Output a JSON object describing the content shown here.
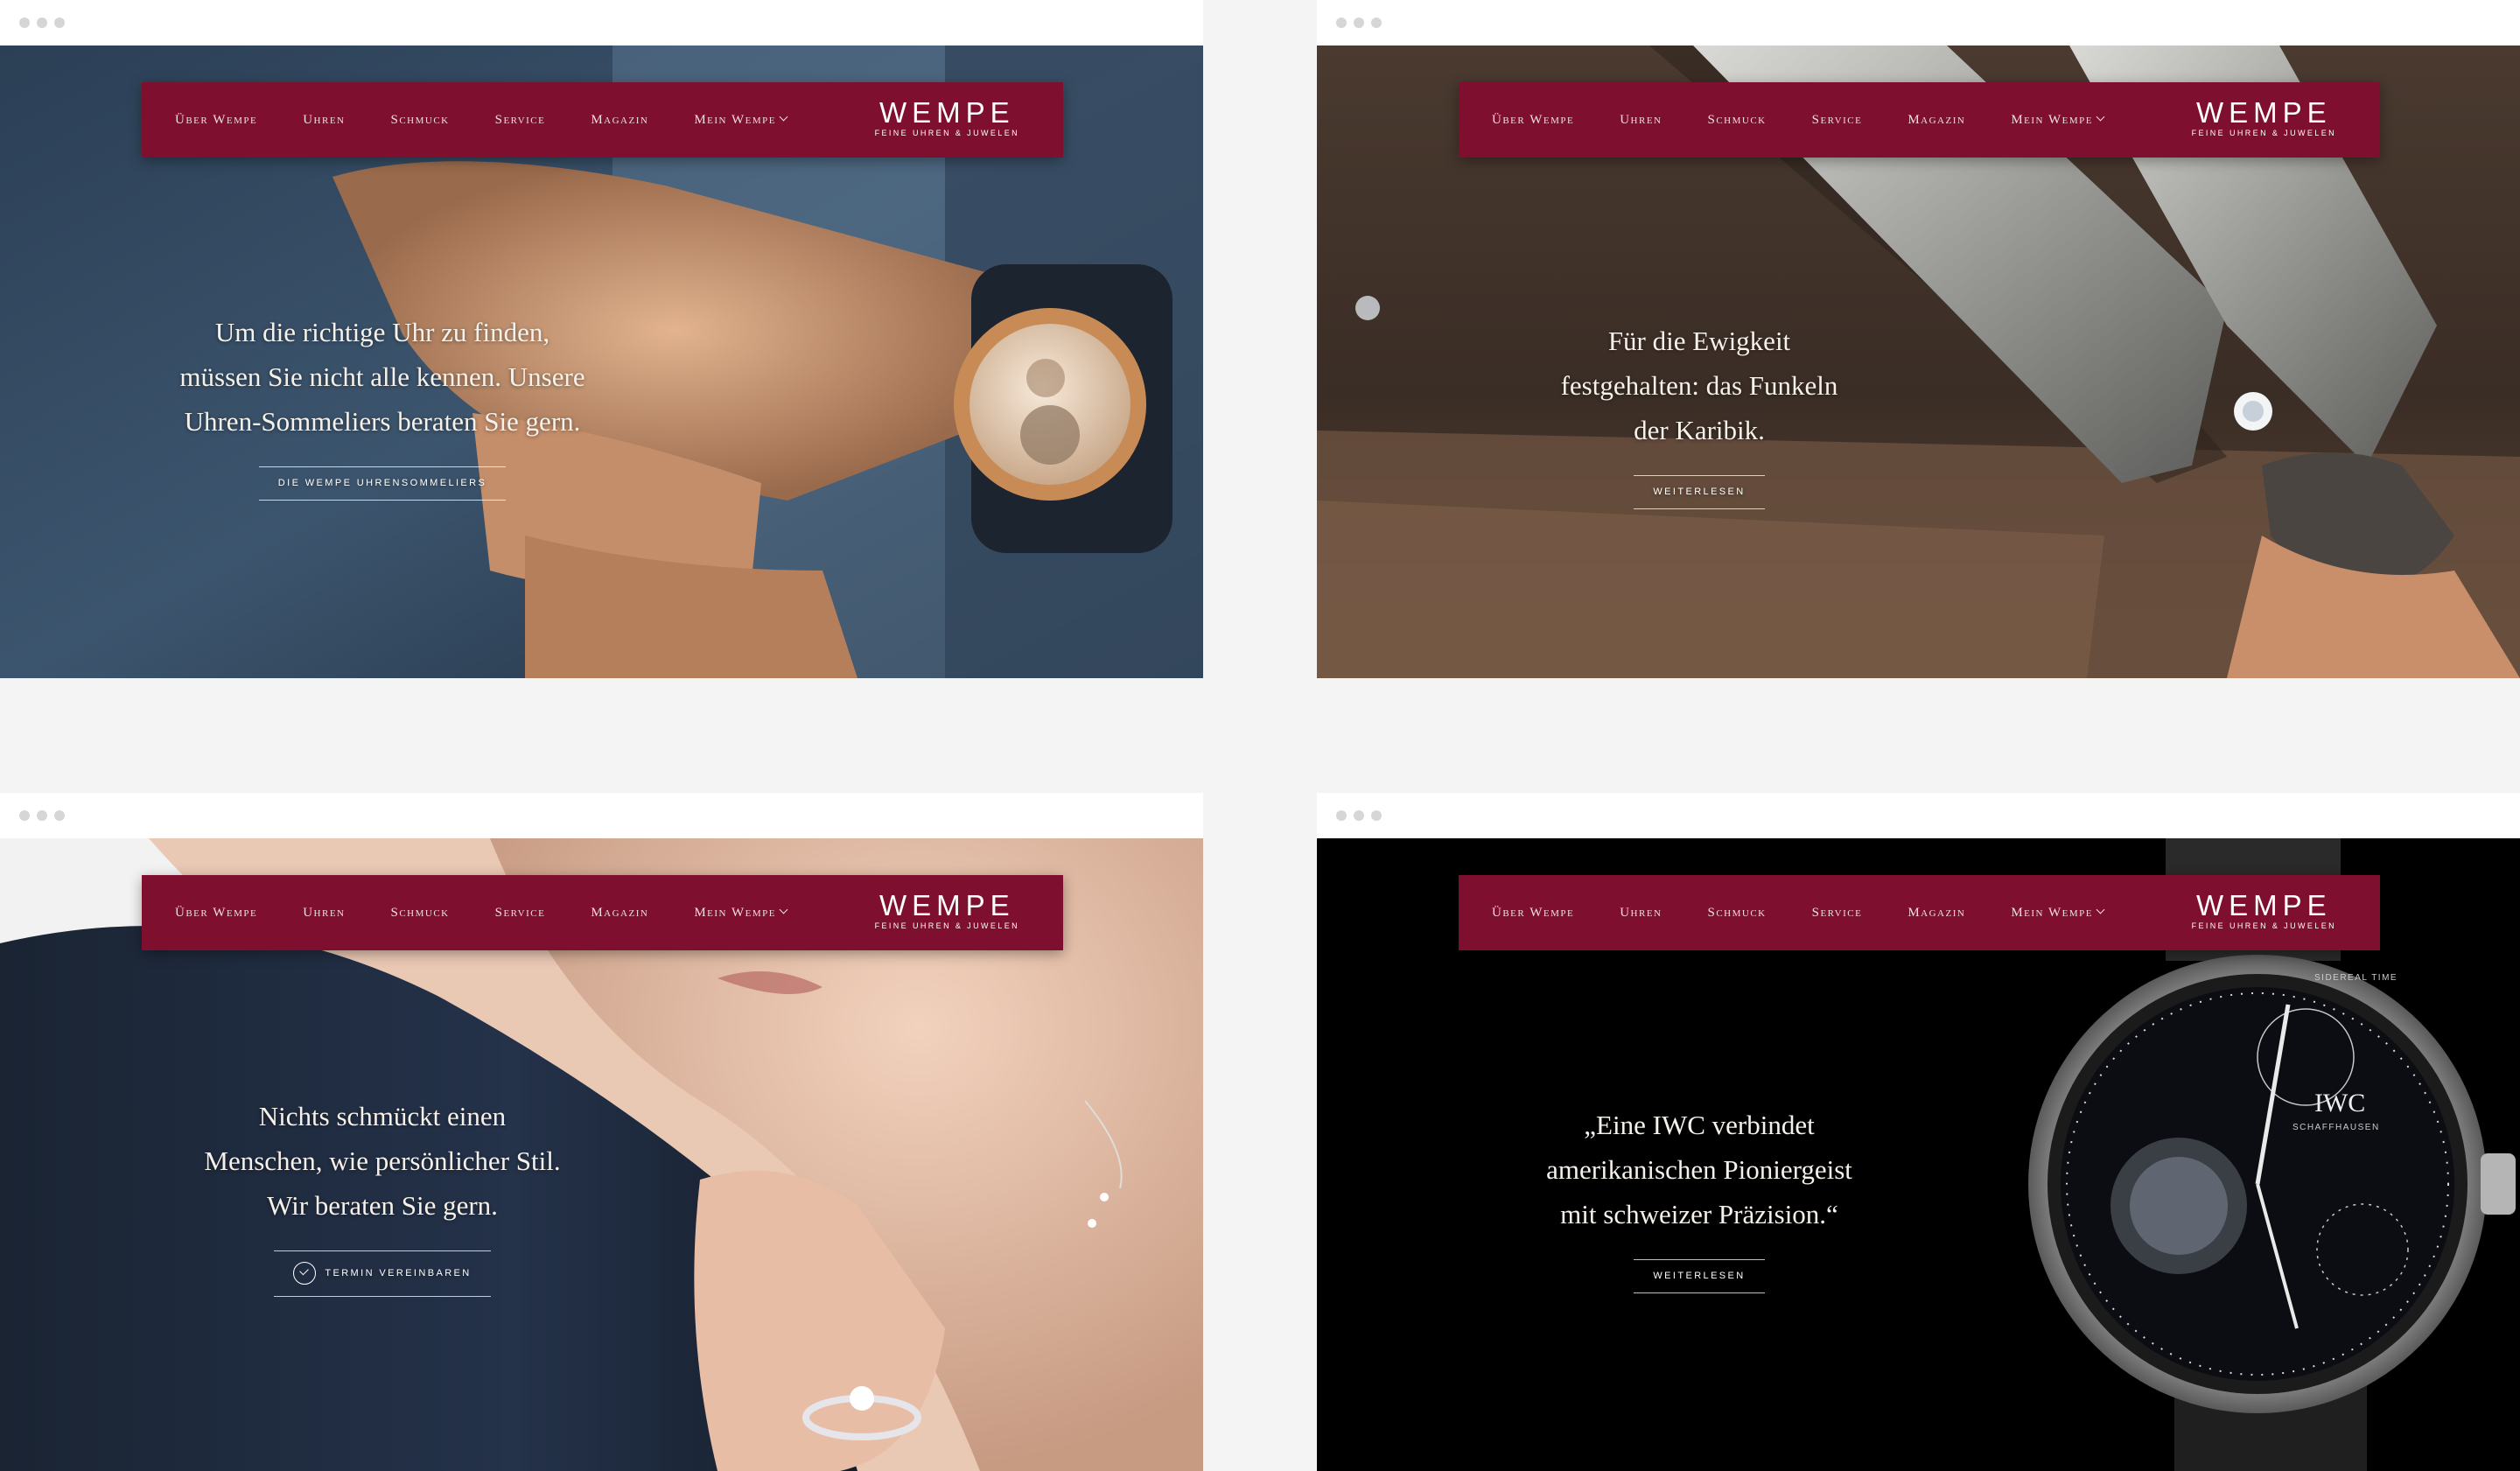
{
  "nav": {
    "items": [
      "Über Wempe",
      "Uhren",
      "Schmuck",
      "Service",
      "Magazin",
      "Mein Wempe"
    ],
    "logo_word": "WEMPE",
    "logo_sub": "FEINE UHREN & JUWELEN"
  },
  "slides": [
    {
      "lines": [
        "Um die richtige Uhr zu finden,",
        "müssen Sie nicht alle kennen. Unsere",
        "Uhren-Sommeliers beraten Sie gern."
      ],
      "cta": "DIE WEMPE UHRENSOMMELIERS"
    },
    {
      "lines": [
        "Für die Ewigkeit",
        "festgehalten: das Funkeln",
        "der Karibik."
      ],
      "cta": "WEITERLESEN"
    },
    {
      "lines": [
        "Nichts schmückt einen",
        "Menschen, wie persönlicher Stil.",
        "Wir beraten Sie gern."
      ],
      "cta": "TERMIN VEREINBAREN"
    },
    {
      "lines": [
        "„Eine IWC verbindet",
        "amerikanischen Pioniergeist",
        "mit schweizer Präzision.“"
      ],
      "cta": "WEITERLESEN"
    }
  ],
  "watch_brand": "IWC",
  "watch_sub": "SCHAFFHAUSEN",
  "watch_ring": "SIDEREAL TIME",
  "colors": {
    "brand": "#7e0f2e",
    "page": "#f4f4f4"
  }
}
